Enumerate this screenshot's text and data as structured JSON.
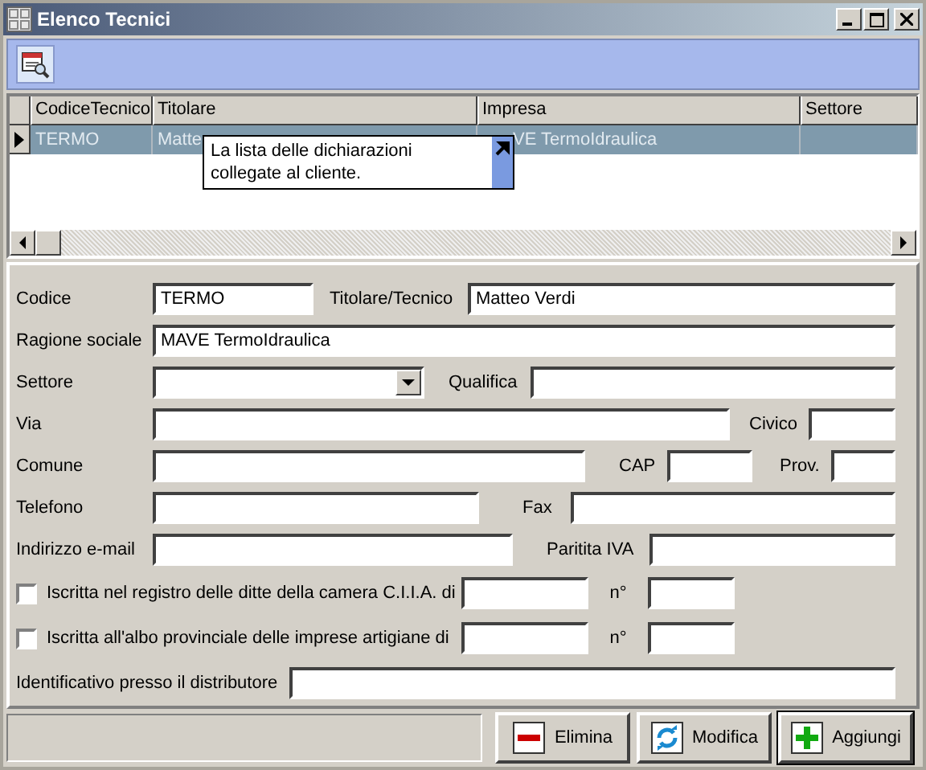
{
  "window": {
    "title": "Elenco Tecnici"
  },
  "grid": {
    "columns": [
      "CodiceTecnico",
      "Titolare",
      "Impresa",
      "Settore"
    ],
    "rows": [
      {
        "selected": true,
        "cells": [
          "TERMO",
          "Matte",
          "VE TermoIdraulica"
        ]
      }
    ]
  },
  "tooltip": {
    "text": "La lista delle dichiarazioni collegate al cliente."
  },
  "form": {
    "codice": {
      "label": "Codice",
      "value": "TERMO"
    },
    "titolare": {
      "label": "Titolare/Tecnico",
      "value": "Matteo Verdi"
    },
    "ragione": {
      "label": "Ragione sociale",
      "value": "MAVE TermoIdraulica"
    },
    "settore": {
      "label": "Settore"
    },
    "qualifica": {
      "label": "Qualifica"
    },
    "via": {
      "label": "Via"
    },
    "civico": {
      "label": "Civico"
    },
    "comune": {
      "label": "Comune"
    },
    "cap": {
      "label": "CAP"
    },
    "prov": {
      "label": "Prov."
    },
    "telefono": {
      "label": "Telefono"
    },
    "fax": {
      "label": "Fax"
    },
    "email": {
      "label": "Indirizzo e-mail"
    },
    "iva": {
      "label": "Paritita IVA"
    },
    "cciaa": {
      "label": "Iscritta nel registro delle ditte della camera C.I.I.A. di",
      "checked": false,
      "number_label": "n°"
    },
    "albo": {
      "label": "Iscritta all'albo provinciale delle imprese artigiane di",
      "checked": false,
      "number_label": "n°"
    },
    "identificativo": {
      "label": "Identificativo presso il distributore"
    }
  },
  "buttons": [
    {
      "kind": "delete",
      "label": "Elimina",
      "default": false
    },
    {
      "kind": "edit",
      "label": "Modifica",
      "default": false
    },
    {
      "kind": "add",
      "label": "Aggiungi",
      "default": true
    }
  ]
}
